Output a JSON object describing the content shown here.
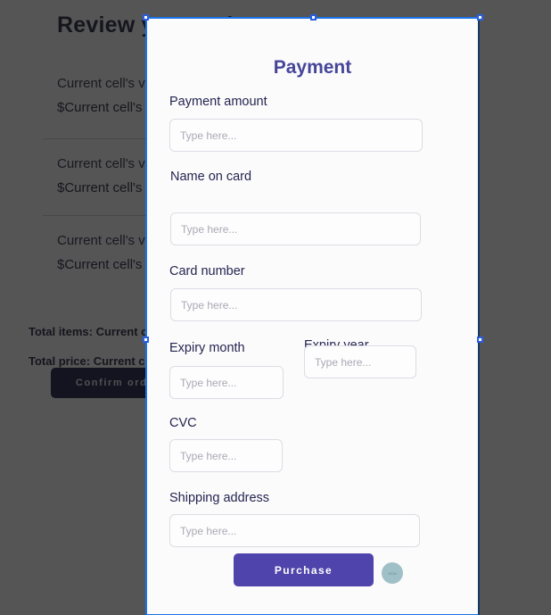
{
  "background_page": {
    "heading": "Review your order",
    "cart_items": [
      {
        "name": "Current cell's value",
        "price": "$Current cell's value"
      },
      {
        "name": "Current cell's value",
        "price": "$Current cell's value"
      },
      {
        "name": "Current cell's value",
        "price": "$Current cell's value"
      }
    ],
    "total_items": "Total items: Current cell's value",
    "total_price": "Total price: Current cell's value",
    "confirm_button": "Confirm order"
  },
  "modal": {
    "title": "Payment",
    "fields": [
      {
        "label": "Payment amount",
        "placeholder": "Type here...",
        "value": ""
      },
      {
        "label": "Name on card",
        "placeholder": "Type here...",
        "value": ""
      },
      {
        "label": "Card number",
        "placeholder": "Type here...",
        "value": ""
      },
      {
        "label": "Expiry month",
        "placeholder": "Type here...",
        "value": ""
      },
      {
        "label": "Expiry year",
        "placeholder": "Type here...",
        "value": ""
      },
      {
        "label": "CVC",
        "placeholder": "Type here...",
        "value": ""
      },
      {
        "label": "Shipping address",
        "placeholder": "Type here...",
        "value": ""
      }
    ],
    "purchase_button": "Purchase",
    "status_badge": "JSON"
  },
  "colors": {
    "modal_title": "#464699",
    "purchase_button": "#4f44ab",
    "confirm_button": "#171740",
    "selection_border": "#1a73e8",
    "badge": "#9fc0c6",
    "overlay": "#141414"
  }
}
